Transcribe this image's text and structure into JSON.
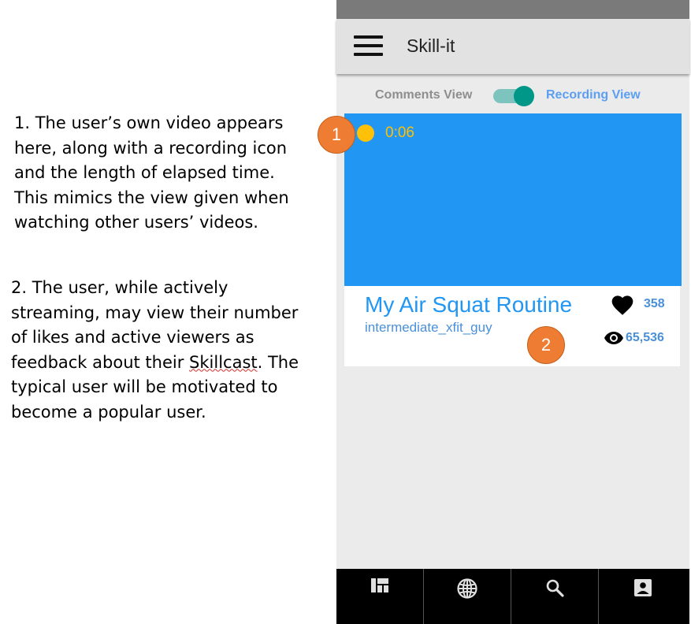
{
  "annotations": {
    "note1": "1. The user’s own video appears\nhere, along with a recording icon\nand the length of elapsed time.\nThis mimics the view given when\nwatching other users’ videos.",
    "note2_before": "2. The user, while actively\nstreaming, may view their number\nof likes and active viewers as\nfeedback about their ",
    "note2_word": "Skillcast",
    "note2_after": ". The\ntypical user will be motivated to\nbecome a popular user.",
    "marker1": "1",
    "marker2": "2"
  },
  "app": {
    "title": "Skill-it",
    "menu_icon": "hamburger-menu-icon"
  },
  "view_toggle": {
    "left_label": "Comments View",
    "right_label": "Recording View",
    "state": "recording"
  },
  "video": {
    "recording_icon": "recording-dot-icon",
    "elapsed": "0:06",
    "title": "My Air Squat Routine",
    "username": "intermediate_xfit_guy",
    "likes": "358",
    "views": "65,536"
  },
  "bottom_nav": {
    "items": [
      {
        "icon": "dashboard-icon"
      },
      {
        "icon": "globe-icon"
      },
      {
        "icon": "search-icon"
      },
      {
        "icon": "profile-icon"
      }
    ]
  },
  "colors": {
    "video_bg": "#2196f3",
    "accent_teal": "#009688",
    "recording": "#ffc107",
    "marker": "#ee7d33",
    "link_blue": "#4a90d9"
  }
}
